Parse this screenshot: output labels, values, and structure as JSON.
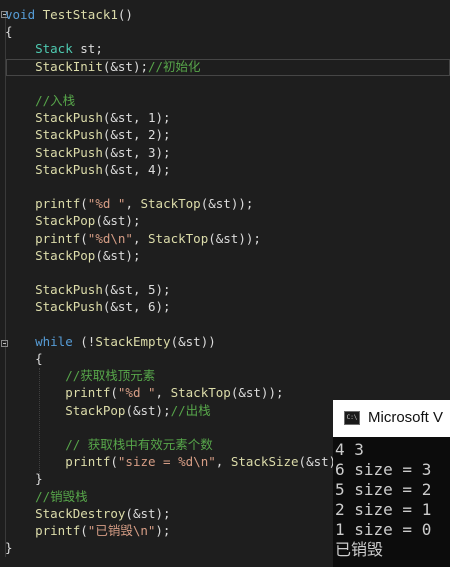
{
  "editor": {
    "lines": [
      {
        "parts": [
          [
            "kw",
            "void"
          ],
          [
            "id",
            " "
          ],
          [
            "fn",
            "TestStack1"
          ],
          [
            "id",
            "()"
          ]
        ]
      },
      {
        "parts": [
          [
            "id",
            "{"
          ]
        ]
      },
      {
        "parts": [
          [
            "id",
            "    "
          ],
          [
            "ty",
            "Stack"
          ],
          [
            "id",
            " st;"
          ]
        ]
      },
      {
        "parts": [
          [
            "id",
            "    "
          ],
          [
            "fn",
            "StackInit"
          ],
          [
            "id",
            "(&st);"
          ],
          [
            "cm",
            "//初始化"
          ]
        ]
      },
      {
        "parts": [
          [
            "id",
            ""
          ]
        ]
      },
      {
        "parts": [
          [
            "id",
            "    "
          ],
          [
            "cm",
            "//入栈"
          ]
        ]
      },
      {
        "parts": [
          [
            "id",
            "    "
          ],
          [
            "fn",
            "StackPush"
          ],
          [
            "id",
            "(&st, 1);"
          ]
        ]
      },
      {
        "parts": [
          [
            "id",
            "    "
          ],
          [
            "fn",
            "StackPush"
          ],
          [
            "id",
            "(&st, 2);"
          ]
        ]
      },
      {
        "parts": [
          [
            "id",
            "    "
          ],
          [
            "fn",
            "StackPush"
          ],
          [
            "id",
            "(&st, 3);"
          ]
        ]
      },
      {
        "parts": [
          [
            "id",
            "    "
          ],
          [
            "fn",
            "StackPush"
          ],
          [
            "id",
            "(&st, 4);"
          ]
        ]
      },
      {
        "parts": [
          [
            "id",
            ""
          ]
        ]
      },
      {
        "parts": [
          [
            "id",
            "    "
          ],
          [
            "fn",
            "printf"
          ],
          [
            "id",
            "("
          ],
          [
            "str",
            "\"%d \""
          ],
          [
            "id",
            ", "
          ],
          [
            "fn",
            "StackTop"
          ],
          [
            "id",
            "(&st));"
          ]
        ]
      },
      {
        "parts": [
          [
            "id",
            "    "
          ],
          [
            "fn",
            "StackPop"
          ],
          [
            "id",
            "(&st);"
          ]
        ]
      },
      {
        "parts": [
          [
            "id",
            "    "
          ],
          [
            "fn",
            "printf"
          ],
          [
            "id",
            "("
          ],
          [
            "str",
            "\"%d\\n\""
          ],
          [
            "id",
            ", "
          ],
          [
            "fn",
            "StackTop"
          ],
          [
            "id",
            "(&st));"
          ]
        ]
      },
      {
        "parts": [
          [
            "id",
            "    "
          ],
          [
            "fn",
            "StackPop"
          ],
          [
            "id",
            "(&st);"
          ]
        ]
      },
      {
        "parts": [
          [
            "id",
            ""
          ]
        ]
      },
      {
        "parts": [
          [
            "id",
            "    "
          ],
          [
            "fn",
            "StackPush"
          ],
          [
            "id",
            "(&st, 5);"
          ]
        ]
      },
      {
        "parts": [
          [
            "id",
            "    "
          ],
          [
            "fn",
            "StackPush"
          ],
          [
            "id",
            "(&st, 6);"
          ]
        ]
      },
      {
        "parts": [
          [
            "id",
            ""
          ]
        ]
      },
      {
        "parts": [
          [
            "id",
            "    "
          ],
          [
            "kw",
            "while"
          ],
          [
            "id",
            " (!"
          ],
          [
            "fn",
            "StackEmpty"
          ],
          [
            "id",
            "(&st))"
          ]
        ]
      },
      {
        "parts": [
          [
            "id",
            "    {"
          ]
        ]
      },
      {
        "parts": [
          [
            "id",
            "        "
          ],
          [
            "cm",
            "//获取栈顶元素"
          ]
        ]
      },
      {
        "parts": [
          [
            "id",
            "        "
          ],
          [
            "fn",
            "printf"
          ],
          [
            "id",
            "("
          ],
          [
            "str",
            "\"%d \""
          ],
          [
            "id",
            ", "
          ],
          [
            "fn",
            "StackTop"
          ],
          [
            "id",
            "(&st));"
          ]
        ]
      },
      {
        "parts": [
          [
            "id",
            "        "
          ],
          [
            "fn",
            "StackPop"
          ],
          [
            "id",
            "(&st);"
          ],
          [
            "cm",
            "//出栈"
          ]
        ]
      },
      {
        "parts": [
          [
            "id",
            ""
          ]
        ]
      },
      {
        "parts": [
          [
            "id",
            "        "
          ],
          [
            "cm",
            "// 获取栈中有效元素个数"
          ]
        ]
      },
      {
        "parts": [
          [
            "id",
            "        "
          ],
          [
            "fn",
            "printf"
          ],
          [
            "id",
            "("
          ],
          [
            "str",
            "\"size = %d\\n\""
          ],
          [
            "id",
            ", "
          ],
          [
            "fn",
            "StackSize"
          ],
          [
            "id",
            "(&st));"
          ]
        ]
      },
      {
        "parts": [
          [
            "id",
            "    }"
          ]
        ]
      },
      {
        "parts": [
          [
            "id",
            "    "
          ],
          [
            "cm",
            "//销毁栈"
          ]
        ]
      },
      {
        "parts": [
          [
            "id",
            "    "
          ],
          [
            "fn",
            "StackDestroy"
          ],
          [
            "id",
            "(&st);"
          ]
        ]
      },
      {
        "parts": [
          [
            "id",
            "    "
          ],
          [
            "fn",
            "printf"
          ],
          [
            "id",
            "("
          ],
          [
            "str",
            "\"已销毁\\n\""
          ],
          [
            "id",
            ");"
          ]
        ]
      },
      {
        "parts": [
          [
            "id",
            "}"
          ]
        ]
      }
    ]
  },
  "console": {
    "title": "Microsoft V",
    "icon_text": "C:\\",
    "output": "4 3\n6 size = 3\n5 size = 2\n2 size = 1\n1 size = 0\n已销毁"
  },
  "colors": {
    "keyword": "#569cd6",
    "function": "#dcdcaa",
    "string": "#d69d85",
    "comment": "#57a64a",
    "type": "#4ec9b0",
    "text": "#dcdcdc",
    "background": "#1e1e1e"
  }
}
